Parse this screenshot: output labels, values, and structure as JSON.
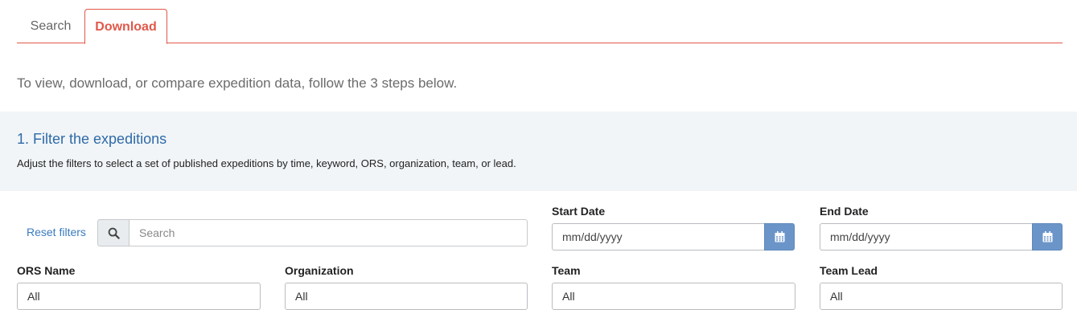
{
  "tabs": [
    {
      "label": "Search",
      "active": false
    },
    {
      "label": "Download",
      "active": true
    }
  ],
  "intro_text": "To view, download, or compare expedition data, follow the 3 steps below.",
  "step1": {
    "title": "1. Filter the expeditions",
    "description": "Adjust the filters to select a set of published expeditions by time, keyword, ORS, organization, team, or lead."
  },
  "filters": {
    "reset_label": "Reset filters",
    "search": {
      "placeholder": "Search",
      "icon": "search-icon"
    },
    "start_date": {
      "label": "Start Date",
      "value": "mm/dd/yyyy",
      "icon": "calendar-icon"
    },
    "end_date": {
      "label": "End Date",
      "value": "mm/dd/yyyy",
      "icon": "calendar-icon"
    },
    "ors_name": {
      "label": "ORS Name",
      "value": "All"
    },
    "organization": {
      "label": "Organization",
      "value": "All"
    },
    "team": {
      "label": "Team",
      "value": "All"
    },
    "team_lead": {
      "label": "Team Lead",
      "value": "All"
    }
  },
  "colors": {
    "accent": "#e0584a",
    "link": "#3a7abf",
    "heading": "#2f6aa8",
    "band": "#f1f5f7",
    "date_button": "#6b95c8"
  }
}
